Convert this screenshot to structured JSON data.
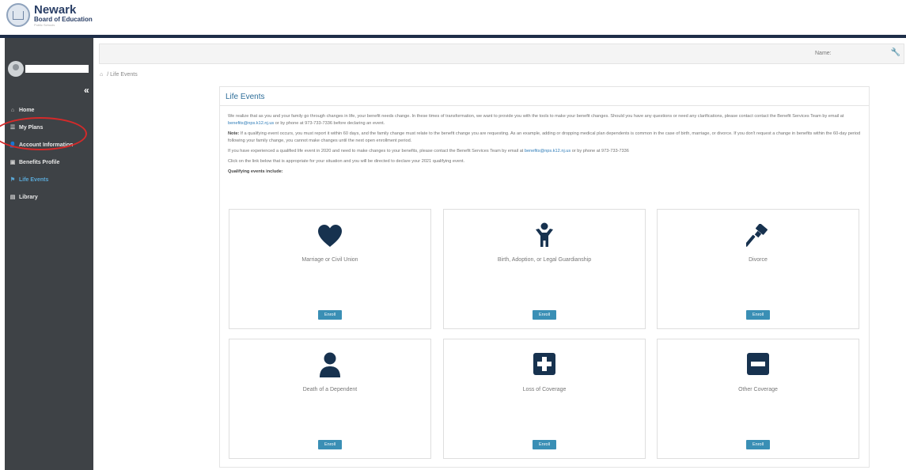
{
  "header": {
    "logo_main": "Newark",
    "logo_sub": "Board of Education",
    "logo_tagline": "Public Schools"
  },
  "sidebar": {
    "collapse_glyph": "«",
    "items": [
      {
        "label": "Home",
        "icon": "home-icon",
        "glyph": "⌂",
        "active": false
      },
      {
        "label": "My Plans",
        "icon": "list-icon",
        "glyph": "☰",
        "active": false
      },
      {
        "label": "Account Information",
        "icon": "user-icon",
        "glyph": "👤",
        "active": false
      },
      {
        "label": "Benefits Profile",
        "icon": "briefcase-icon",
        "glyph": "▣",
        "active": false
      },
      {
        "label": "Life Events",
        "icon": "calendar-icon",
        "glyph": "⚑",
        "active": true
      },
      {
        "label": "Library",
        "icon": "book-icon",
        "glyph": "▤",
        "active": false
      }
    ]
  },
  "filterbar": {
    "label": "Name:",
    "wrench_glyph": "🔧"
  },
  "breadcrumb": {
    "home_glyph": "⌂",
    "separator": "/",
    "current": "Life Events"
  },
  "card": {
    "title": "Life Events",
    "para1_a": "We realize that as you and your family go through changes in life, your benefit needs change. In these times of transformation, we want to provide you with the tools to make your benefit changes. Should you have any questions or need any clarifications, please contact contact the Benefit Services Team by email at ",
    "para1_email": "benefits@nps.k12.nj.us",
    "para1_b": " or by phone at 973-733-7336 before declaring an event.",
    "note_label": "Note:",
    "note_text": " If a qualifying event occurs, you must report it within 60 days, and the family change must relate to the benefit change you are requesting. As an example, adding or dropping medical plan dependents is common in the case of birth, marriage, or divorce. If you don't request a change in benefits within the 60-day period following your family change, you cannot make changes until the next open enrollment period.",
    "para3_a": "If you have experienced a qualified life event in 2020 and need to make changes to your benefits, please contact the Benefit Services Team by email at ",
    "para3_email": "benefits@nps.k12.nj.us",
    "para3_b": " or by phone at 973-733-7336",
    "para4": "Click on the link below that is appropriate for your situation and you will be directed to declare your 2021 qualifying event.",
    "qualifying": "Qualifying events include:"
  },
  "events": [
    {
      "label": "Marriage or Civil Union",
      "icon": "heart-icon",
      "button": "Enroll"
    },
    {
      "label": "Birth, Adoption, or Legal Guardianship",
      "icon": "child-icon",
      "button": "Enroll"
    },
    {
      "label": "Divorce",
      "icon": "gavel-icon",
      "button": "Enroll"
    },
    {
      "label": "Death of a Dependent",
      "icon": "person-icon",
      "button": "Enroll"
    },
    {
      "label": "Loss of Coverage",
      "icon": "plus-square-icon",
      "button": "Enroll"
    },
    {
      "label": "Other Coverage",
      "icon": "minus-square-icon",
      "button": "Enroll"
    }
  ],
  "colors": {
    "sidebar_bg": "#3e4246",
    "topbar": "#1e2e48",
    "accent": "#2e6e99",
    "button": "#3a8fb5",
    "icon_dark": "#17324f",
    "highlight_ring": "#d42a2a"
  }
}
